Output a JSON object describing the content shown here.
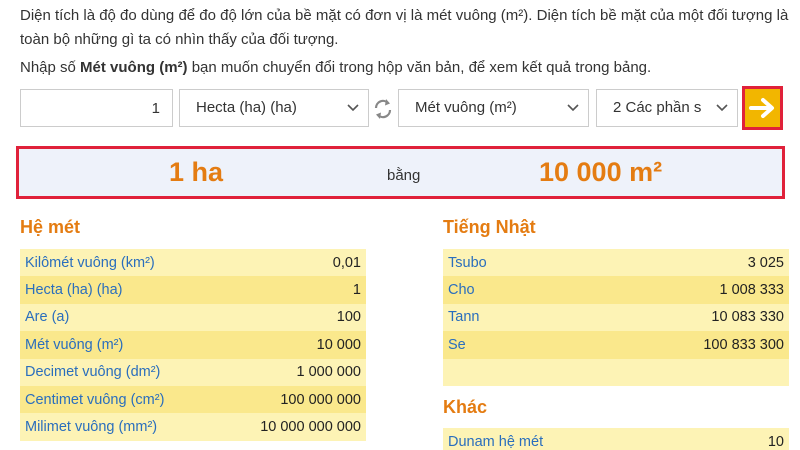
{
  "intro_text": "Diện tích là độ đo dùng để đo độ lớn của bề mặt có đơn vị là mét vuông (m²). Diện tích bề mặt của một đối tượng là toàn bộ những gì ta có nhìn thấy của đối tượng.",
  "instruction": {
    "before": "Nhập số ",
    "bold": "Mét vuông (m²)",
    "after": " bạn muốn chuyển đổi trong hộp văn bản, để xem kết quả trong bảng."
  },
  "converter": {
    "quantity": "1",
    "from_unit": "Hecta (ha) (ha)",
    "to_unit": "Mét vuông (m²)",
    "precision": "2 Các phần s",
    "swap_icon": "swap-arrows-icon",
    "go_icon": "arrow-right-icon"
  },
  "result": {
    "from": "1 ha",
    "equals": "bằng",
    "to": "10 000 m²"
  },
  "sections": {
    "metric": {
      "title": "Hệ mét",
      "rows": [
        {
          "name": "Kilômét vuông (km²)",
          "value": "0,01"
        },
        {
          "name": "Hecta (ha) (ha)",
          "value": "1"
        },
        {
          "name": "Are (a)",
          "value": "100"
        },
        {
          "name": "Mét vuông (m²)",
          "value": "10 000"
        },
        {
          "name": "Decimet vuông (dm²)",
          "value": "1 000 000"
        },
        {
          "name": "Centimet vuông (cm²)",
          "value": "100 000 000"
        },
        {
          "name": "Milimet vuông (mm²)",
          "value": "10 000 000 000"
        }
      ]
    },
    "japanese": {
      "title": "Tiếng Nhật",
      "rows": [
        {
          "name": "Tsubo",
          "value": "3 025"
        },
        {
          "name": "Cho",
          "value": "1 008 333"
        },
        {
          "name": "Tann",
          "value": "10 083 330"
        },
        {
          "name": "Se",
          "value": "100 833 300"
        }
      ]
    },
    "other": {
      "title": "Khác",
      "rows": [
        {
          "name": "Dunam hệ mét",
          "value": "10"
        }
      ]
    }
  },
  "colors": {
    "accent_orange": "#e47c12",
    "highlight_red": "#e0213a",
    "go_button": "#f2b600",
    "link_blue": "#2a6ebd",
    "row_light": "#fdf3b5",
    "row_dark": "#fae88c"
  }
}
